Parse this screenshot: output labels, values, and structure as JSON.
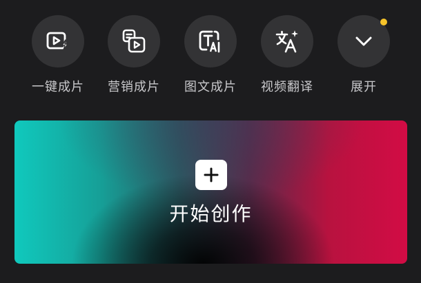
{
  "tools": [
    {
      "label": "一键成片",
      "icon": "play-bolt-icon"
    },
    {
      "label": "营销成片",
      "icon": "marketing-video-icon"
    },
    {
      "label": "图文成片",
      "icon": "text-ai-icon"
    },
    {
      "label": "视频翻译",
      "icon": "translate-icon"
    },
    {
      "label": "展开",
      "icon": "chevron-down-icon"
    }
  ],
  "create": {
    "label": "开始创作",
    "icon": "plus-icon"
  },
  "colors": {
    "background": "#1c1c1e",
    "tool_circle": "#333335",
    "tool_label": "#c9c9cc",
    "notification_dot": "#f6c32a",
    "gradient_teal": "#10c9bd",
    "gradient_red": "#d20c45"
  }
}
